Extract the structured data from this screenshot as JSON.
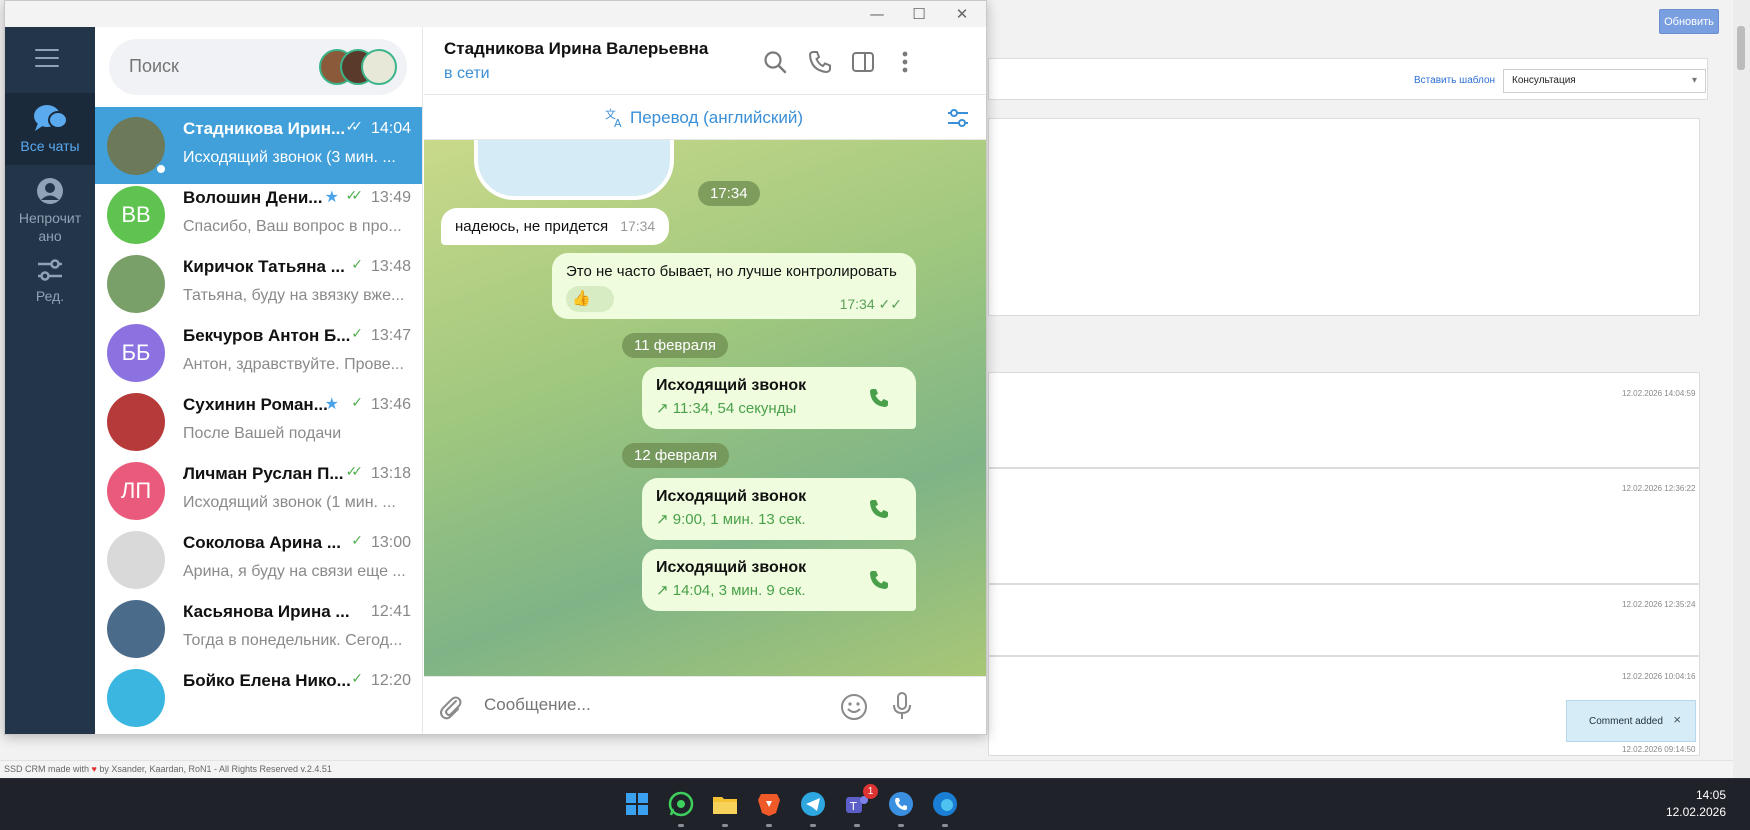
{
  "crm": {
    "refresh_label": "Обновить",
    "insert_template_label": "Вставить шаблон",
    "template_select_value": "Консультация",
    "timestamps": [
      "12.02.2026 14:04:59",
      "12.02.2026 12:36:22",
      "12.02.2026 12:35:24",
      "12.02.2026 10:04:16",
      "12.02.2026 09:14:50"
    ],
    "toast_text": "Comment added",
    "toast_close": "×",
    "footer_prefix": "SSD CRM made with",
    "footer_heart": "♥",
    "footer_suffix": "by Xsander, Kaardan, RoN1 - All Rights Reserved v.2.4.51"
  },
  "window": {
    "minimize": "—",
    "maximize": "☐",
    "close": "✕"
  },
  "rail": {
    "items": [
      {
        "label": "Все чаты",
        "icon": "chats-icon"
      },
      {
        "label": "Непрочит ано",
        "icon": "person-icon"
      },
      {
        "label": "Ред.",
        "icon": "edit-filters-icon"
      }
    ]
  },
  "search": {
    "placeholder": "Поиск"
  },
  "chats": [
    {
      "name": "Стадникова Ирин...",
      "time": "14:04",
      "preview": "Исходящий звонок (3 мин. ...",
      "initials": "",
      "avatar_color": "#6d7a5a",
      "ticks": "✓✓",
      "star": false
    },
    {
      "name": "Волошин Дени...",
      "time": "13:49",
      "preview": "Спасибо, Ваш вопрос в про...",
      "initials": "ВВ",
      "avatar_color": "#5fc44f",
      "ticks": "✓✓",
      "star": true
    },
    {
      "name": "Киричок Татьяна ...",
      "time": "13:48",
      "preview": "Татьяна, буду на звязку вже...",
      "initials": "",
      "avatar_color": "#7aa06a",
      "ticks": "✓",
      "star": false
    },
    {
      "name": "Бекчуров Антон Б...",
      "time": "13:47",
      "preview": "Антон, здравствуйте. Прове...",
      "initials": "ББ",
      "avatar_color": "#8b72e0",
      "ticks": "✓",
      "star": false
    },
    {
      "name": "Сухинин Роман...",
      "time": "13:46",
      "preview": "После Вашей подачи",
      "initials": "",
      "avatar_color": "#b73a3a",
      "ticks": "✓",
      "star": true
    },
    {
      "name": "Личман Руслан П...",
      "time": "13:18",
      "preview": "Исходящий звонок (1 мин. ...",
      "initials": "ЛП",
      "avatar_color": "#ea5a7c",
      "ticks": "✓✓",
      "star": false
    },
    {
      "name": "Соколова Арина ...",
      "time": "13:00",
      "preview": "Арина, я буду на связи еще ...",
      "initials": "",
      "avatar_color": "#d9d9d9",
      "ticks": "✓",
      "star": false
    },
    {
      "name": "Касьянова Ирина ...",
      "time": "12:41",
      "preview": "Тогда в понедельник. Сегод...",
      "initials": "",
      "avatar_color": "#4b6b8a",
      "ticks": "",
      "star": false
    },
    {
      "name": "Бойко Елена Нико...",
      "time": "12:20",
      "preview": "",
      "initials": "",
      "avatar_color": "#3ab6e0",
      "ticks": "✓",
      "star": false
    }
  ],
  "chat": {
    "title": "Стадникова Ирина Валерьевна",
    "status": "в сети",
    "translate_label": "Перевод (английский)",
    "composer_placeholder": "Сообщение...",
    "messages": {
      "date1": "17:34",
      "in1_text": "надеюсь, не придется",
      "in1_time": "17:34",
      "out1_text": "Это не часто бывает, но лучше контролировать",
      "out1_reaction": "👍",
      "out1_time": "17:34",
      "date2": "11 февраля",
      "call1_title": "Исходящий звонок",
      "call1_sub": "↗ 11:34, 54 секунды",
      "date3": "12 февраля",
      "call2_title": "Исходящий звонок",
      "call2_sub": "↗ 9:00, 1 мин. 13 сек.",
      "call3_title": "Исходящий звонок",
      "call3_sub": "↗ 14:04, 3 мин. 9 сек."
    }
  },
  "taskbar": {
    "time": "14:05",
    "date": "12.02.2026",
    "teams_badge": "1"
  }
}
